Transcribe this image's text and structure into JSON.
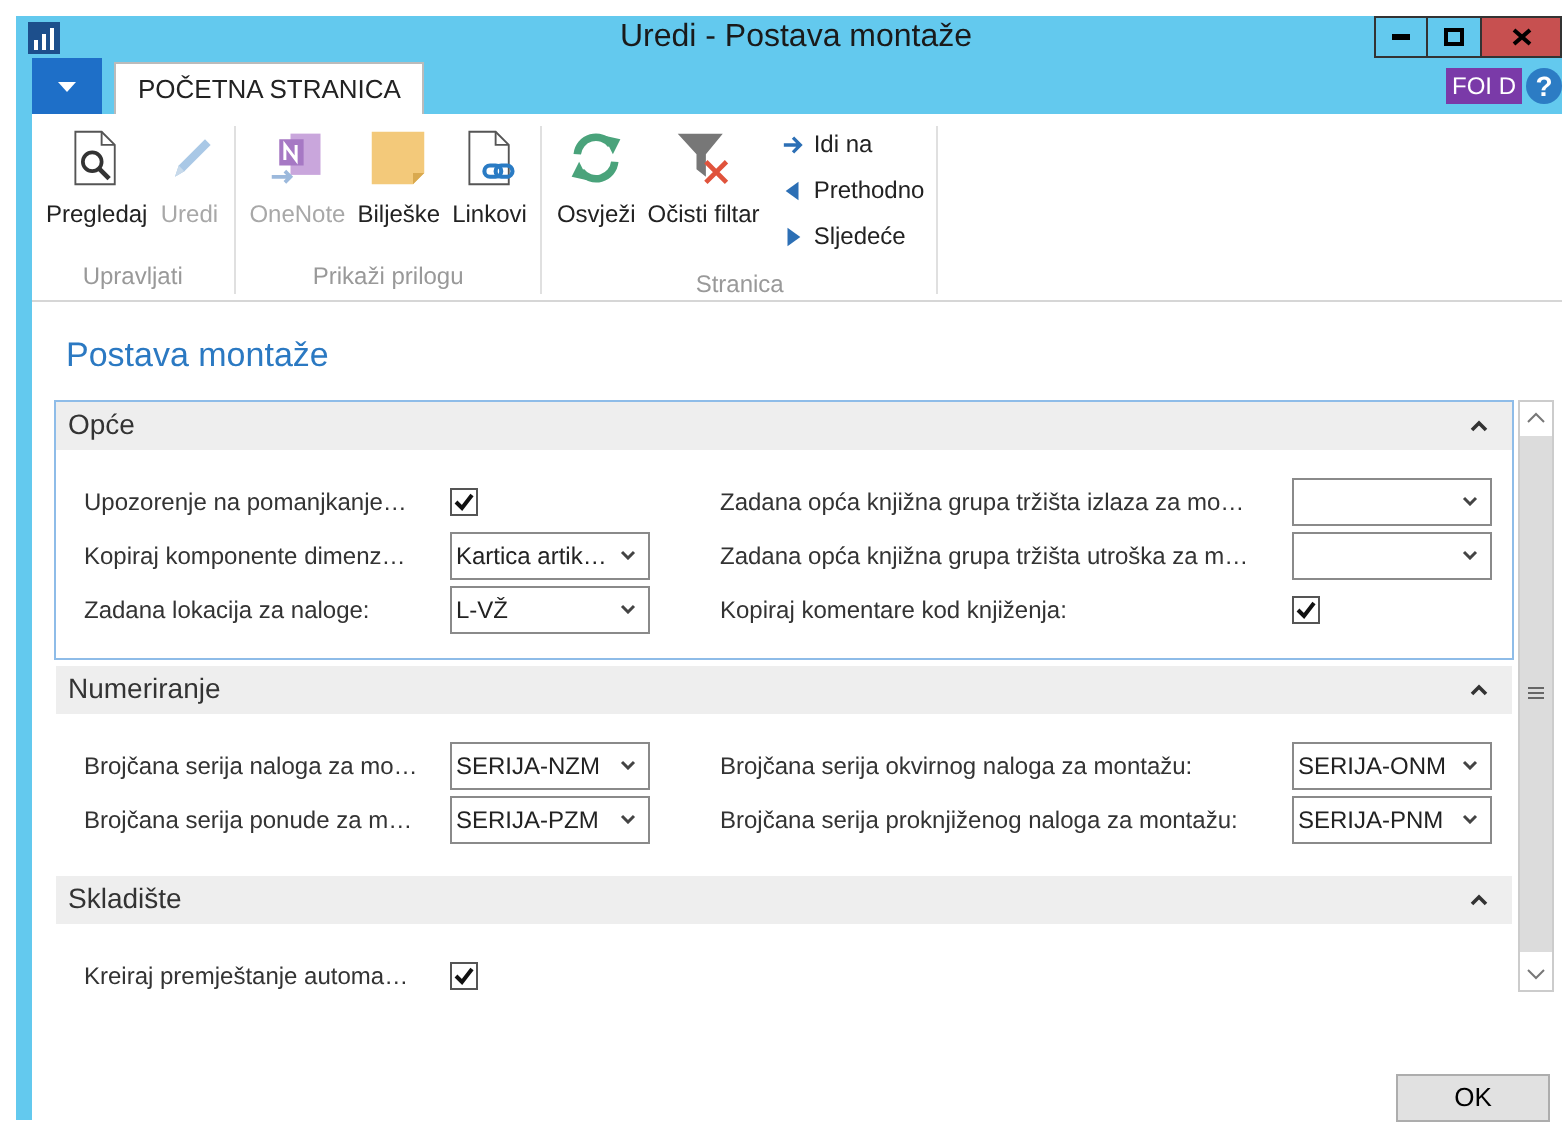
{
  "window": {
    "title": "Uredi - Postava montaže"
  },
  "ribbon": {
    "tabs": [
      {
        "label": "POČETNA STRANICA",
        "selected": true
      }
    ],
    "user_badge": "FOI D",
    "help": "?",
    "groups": [
      {
        "label": "Upravljati",
        "buttons": [
          {
            "kind": "large",
            "label": "Pregledaj",
            "disabled": false
          },
          {
            "kind": "large",
            "label": "Uredi",
            "disabled": true
          }
        ]
      },
      {
        "label": "Prikaži prilogu",
        "buttons": [
          {
            "kind": "large",
            "label": "OneNote",
            "disabled": true
          },
          {
            "kind": "large",
            "label": "Bilješke",
            "disabled": false
          },
          {
            "kind": "large",
            "label": "Linkovi",
            "disabled": false
          }
        ]
      },
      {
        "label": "Stranica",
        "buttons": [
          {
            "kind": "large",
            "label": "Osvježi",
            "disabled": false
          },
          {
            "kind": "large",
            "label": "Očisti filtar",
            "disabled": false
          },
          {
            "kind": "small",
            "label": "Idi na",
            "disabled": false
          },
          {
            "kind": "small",
            "label": "Prethodno",
            "disabled": false
          },
          {
            "kind": "small",
            "label": "Sljedeće",
            "disabled": false
          }
        ]
      }
    ]
  },
  "page_title": "Postava montaže",
  "sections": [
    {
      "title": "Opće",
      "expanded": true,
      "focused": true,
      "columns": [
        [
          {
            "kind": "checkbox",
            "label": "Upozorenje na pomanjkanje…",
            "checked": true
          },
          {
            "kind": "dropdown",
            "label": "Kopiraj komponente dimenz…",
            "value": "Kartica artik…"
          },
          {
            "kind": "dropdown",
            "label": "Zadana lokacija za naloge:",
            "value": "L-VŽ"
          }
        ],
        [
          {
            "kind": "dropdown",
            "label": "Zadana opća knjižna grupa tržišta izlaza za mo…"
          },
          {
            "kind": "dropdown",
            "label": "Zadana opća knjižna grupa tržišta utroška za m…"
          },
          {
            "kind": "checkbox",
            "label": "Kopiraj komentare kod knjiženja:",
            "checked": true
          }
        ]
      ]
    },
    {
      "title": "Numeriranje",
      "expanded": true,
      "focused": false,
      "columns": [
        [
          {
            "kind": "dropdown",
            "label": "Brojčana serija naloga za mo…",
            "value": "SERIJA-NZM"
          },
          {
            "kind": "dropdown",
            "label": "Brojčana serija ponude za m…",
            "value": "SERIJA-PZM"
          }
        ],
        [
          {
            "kind": "dropdown",
            "label": "Brojčana serija okvirnog naloga za montažu:",
            "value": "SERIJA-ONM"
          },
          {
            "kind": "dropdown",
            "label": "Brojčana serija proknjiženog naloga za montažu:",
            "value": "SERIJA-PNM"
          }
        ]
      ]
    },
    {
      "title": "Skladište",
      "expanded": true,
      "focused": false,
      "columns": [
        [
          {
            "kind": "checkbox",
            "label": "Kreiraj premještanje automa…",
            "checked": true
          }
        ],
        []
      ]
    }
  ],
  "ok_button": "OK"
}
